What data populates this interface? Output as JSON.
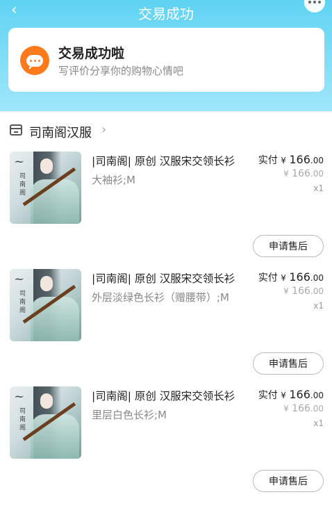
{
  "header": {
    "title": "交易成功"
  },
  "status": {
    "title": "交易成功啦",
    "subtitle": "写评价分享你的购物心情吧"
  },
  "shop": {
    "name": "司南阁汉服"
  },
  "items": [
    {
      "name": "|司南阁| 原创 汉服宋交领长衫",
      "sku": "大袖衫;M",
      "paid_label": "实付",
      "currency": "¥",
      "paid_int": "166",
      "paid_dec": ".00",
      "orig_int": "166",
      "orig_dec": ".00",
      "qty": "x1",
      "after_sales": "申请售后",
      "thumb_text": "司南阁"
    },
    {
      "name": "|司南阁| 原创 汉服宋交领长衫",
      "sku": "外层淡绿色长衫（赠腰带）;M",
      "paid_label": "实付",
      "currency": "¥",
      "paid_int": "166",
      "paid_dec": ".00",
      "orig_int": "166",
      "orig_dec": ".00",
      "qty": "x1",
      "after_sales": "申请售后",
      "thumb_text": "司南阁"
    },
    {
      "name": "|司南阁| 原创 汉服宋交领长衫",
      "sku": "里层白色长衫;M",
      "paid_label": "实付",
      "currency": "¥",
      "paid_int": "166",
      "paid_dec": ".00",
      "orig_int": "166",
      "orig_dec": ".00",
      "qty": "x1",
      "after_sales": "申请售后",
      "thumb_text": "司南阁"
    }
  ],
  "colors": {
    "header_top": "#5fd3f3",
    "accent": "#ff7a1a"
  }
}
